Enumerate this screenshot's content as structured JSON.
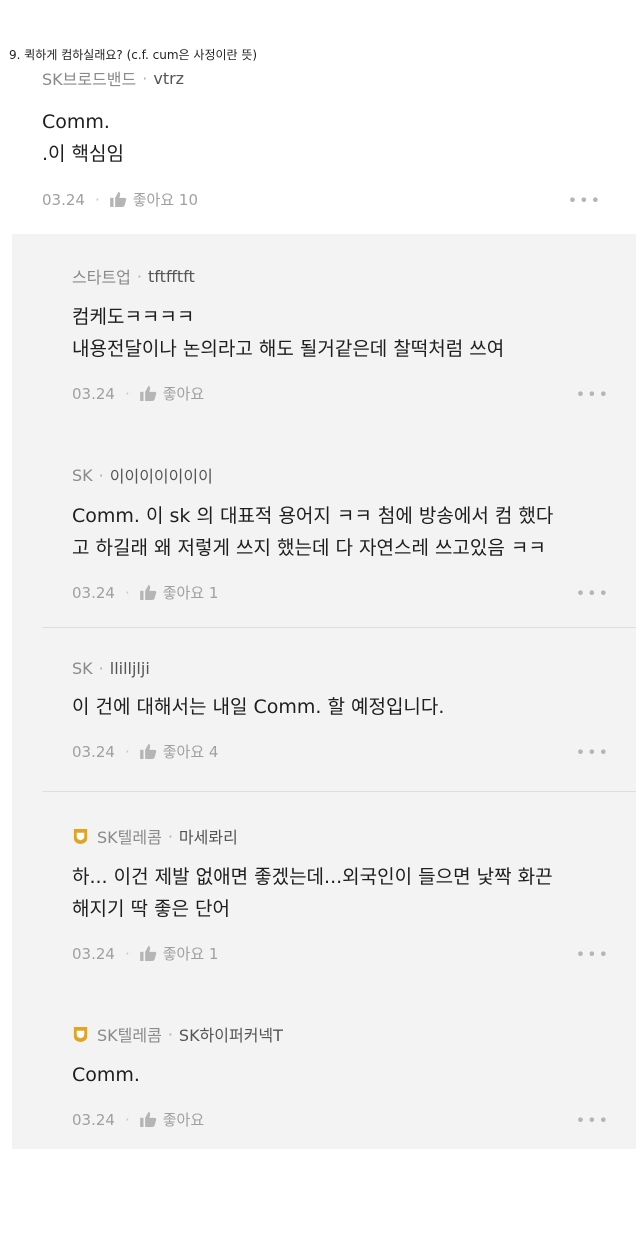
{
  "caption": "9. 퀵하게 컴하실래요? (c.f. cum은 사정이란 뜻)",
  "main_comment": {
    "affiliation": "SK브로드밴드",
    "nickname": "vtrz",
    "lines": [
      "Comm.",
      ".이 핵심임"
    ],
    "date": "03.24",
    "like_label": "좋아요 10"
  },
  "replies": [
    {
      "affiliation": "스타트업",
      "nickname": "tftfftft",
      "lines": [
        "컴케도ㅋㅋㅋㅋ",
        "내용전달이나 논의라고 해도 될거같은데 찰떡처럼 쓰여"
      ],
      "date": "03.24",
      "like_label": "좋아요",
      "verified": false
    },
    {
      "affiliation": "SK",
      "nickname": "이이이이이이이",
      "lines": [
        "Comm. 이 sk 의 대표적 용어지 ㅋㅋ 첨에 방송에서 컴 했다",
        "고 하길래 왜 저렇게  쓰지 했는데 다 자연스레 쓰고있음 ㅋㅋ"
      ],
      "date": "03.24",
      "like_label": "좋아요 1",
      "verified": false
    },
    {
      "affiliation": "SK",
      "nickname": "llilljlji",
      "lines": [
        "이 건에 대해서는 내일 Comm. 할 예정입니다."
      ],
      "date": "03.24",
      "like_label": "좋아요 4",
      "verified": false
    },
    {
      "affiliation": "SK텔레콤",
      "nickname": "마세롸리",
      "lines": [
        "하... 이건 제발 없애면 좋겠는데...외국인이 들으면 낯짝 화끈",
        "해지기 딱 좋은 단어"
      ],
      "date": "03.24",
      "like_label": "좋아요 1",
      "verified": true
    },
    {
      "affiliation": "SK텔레콤",
      "nickname": "SK하이퍼커넥T",
      "lines": [
        "Comm."
      ],
      "date": "03.24",
      "like_label": "좋아요",
      "verified": true
    }
  ],
  "icons": {
    "like": "thumbs-up-icon",
    "more": "more-options-icon",
    "badge": "verified-badge-icon"
  },
  "colors": {
    "reply_background": "#f3f3f3",
    "badge_gold": "#e0a526"
  }
}
